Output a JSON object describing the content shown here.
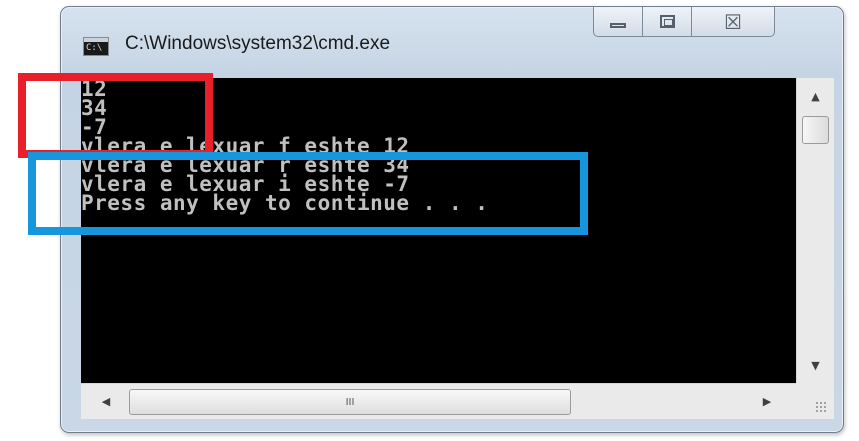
{
  "window": {
    "title": "C:\\Windows\\system32\\cmd.exe",
    "icon": "cmd-icon",
    "icon_text": "C:\\",
    "buttons": {
      "minimize": "minimize-icon",
      "maximize": "maximize-icon",
      "close": "close-icon",
      "close_glyph": "☒"
    }
  },
  "console": {
    "lines": [
      "12",
      "34",
      "-7",
      "vlera e lexuar f eshte 12",
      "vlera e lexuar r eshte 34",
      "vlera e lexuar i eshte -7",
      "Press any key to continue . . ."
    ],
    "text_color": "#c0c0c0",
    "background": "#000000"
  },
  "scrollbars": {
    "hthumb_grip": "III",
    "up_arrow": "▲",
    "down_arrow": "▼",
    "left_arrow": "◀",
    "right_arrow": "▶"
  },
  "annotations": {
    "red_box_color": "#e8202a",
    "blue_box_color": "#1596dd"
  }
}
